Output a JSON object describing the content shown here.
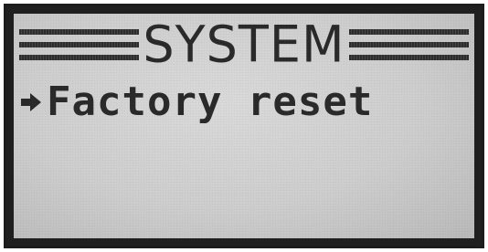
{
  "screen": {
    "title": "SYSTEM",
    "menu": [
      {
        "label": "Factory reset",
        "selected": true,
        "indicator": "right-arrow-icon"
      }
    ]
  },
  "colors": {
    "lcd_background": "#cdcdcd",
    "pixel_on": "#2a2a2a",
    "bezel": "#1c1c1c"
  }
}
